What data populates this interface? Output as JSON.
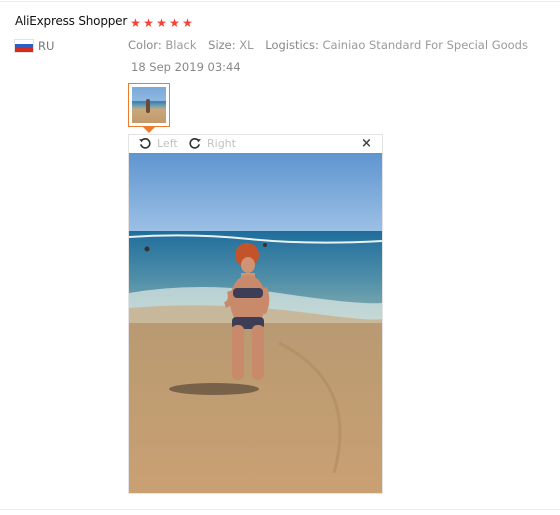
{
  "review": {
    "user_name": "AliExpress Shopper",
    "rating": 5,
    "country": "RU",
    "color_label": "Color:",
    "color_value": "Black",
    "size_label": "Size:",
    "size_value": "XL",
    "logistics_label": "Logistics:",
    "logistics_value": "Cainiao Standard For Special Goods",
    "date": "18 Sep 2019 03:44"
  },
  "viewer": {
    "rotate_left_label": "Left",
    "rotate_right_label": "Right",
    "close_label": "×"
  },
  "colors": {
    "star": "#f44336",
    "thumb_border": "#ef7a2c",
    "meta_text": "#999999"
  },
  "icons": [
    "star-icon",
    "ru-flag-icon",
    "rotate-left-icon",
    "rotate-right-icon",
    "close-icon"
  ]
}
